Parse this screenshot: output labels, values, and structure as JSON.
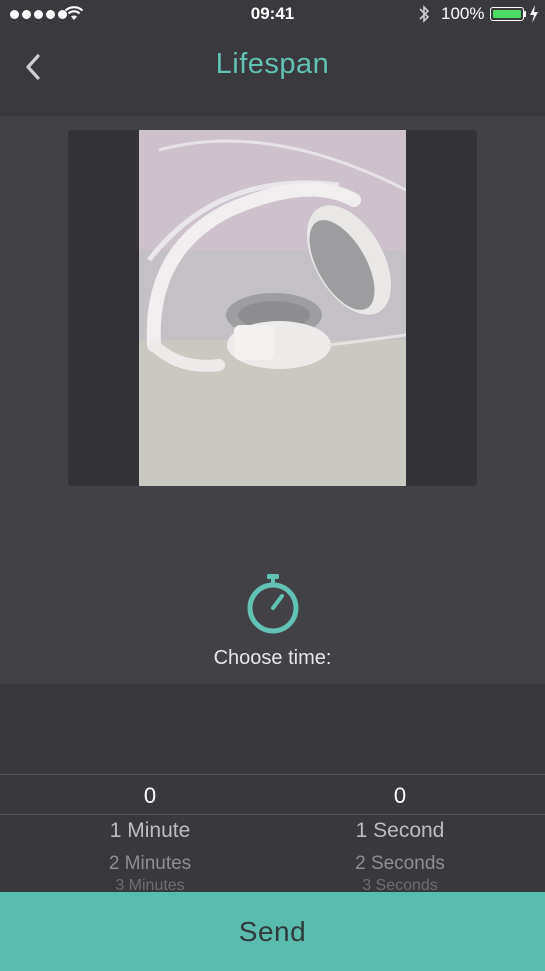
{
  "status_bar": {
    "time": "09:41",
    "battery": "100%",
    "icons": [
      "signal-dots-icon",
      "wifi-icon",
      "bluetooth-icon",
      "battery-icon",
      "charging-bolt-icon"
    ]
  },
  "nav": {
    "back_icon": "chevron-left-icon",
    "title": "Lifespan"
  },
  "image": {
    "subject": "photo-preview"
  },
  "timer": {
    "icon": "stopwatch-icon",
    "label": "Choose time:"
  },
  "picker": {
    "minutes": {
      "selected": "0",
      "options": [
        "1 Minute",
        "2 Minutes",
        "3 Minutes"
      ]
    },
    "seconds": {
      "selected": "0",
      "options": [
        "1 Second",
        "2 Seconds",
        "3 Seconds"
      ]
    }
  },
  "actions": {
    "send_label": "Send"
  },
  "colors": {
    "accent": "#5bbcae",
    "title": "#62c2b4",
    "background": "#424146",
    "picker_bg": "#39383d"
  }
}
